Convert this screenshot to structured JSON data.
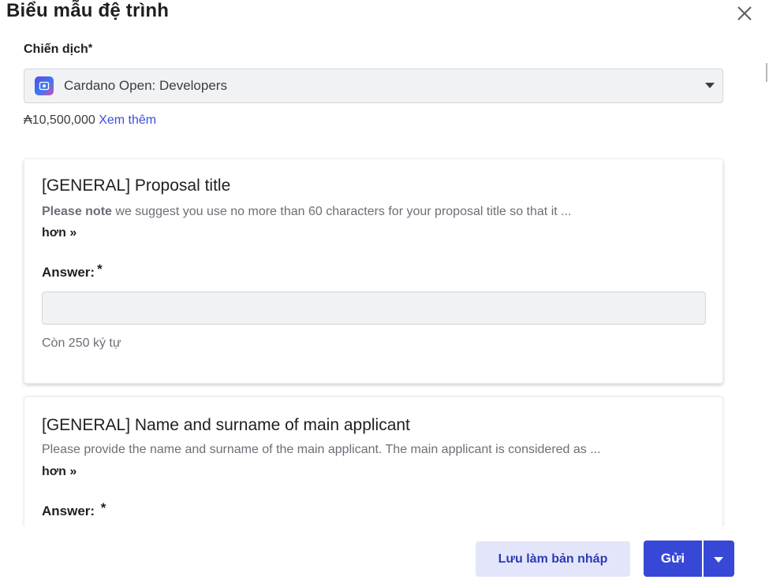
{
  "modal": {
    "title": "Biểu mẫu đệ trình",
    "close_icon": "close-icon"
  },
  "campaign": {
    "label": "Chiến dịch",
    "required_mark": "*",
    "selected": "Cardano Open: Developers",
    "icon": "campaign-logo-icon",
    "budget": "₳10,500,000",
    "more_link": "Xem thêm"
  },
  "questions": [
    {
      "title": "[GENERAL] Proposal title",
      "desc_bold": "Please note",
      "desc": " we suggest you use no more than 60 characters for your proposal title so that it ...",
      "more": "hơn »",
      "answer_label": "Answer:",
      "required_mark": "*",
      "value": "",
      "counter": "Còn 250 ký tự"
    },
    {
      "title": "[GENERAL] Name and surname of main applicant",
      "desc_bold": "",
      "desc": "Please provide the name and surname of the main applicant. The main applicant is considered as ...",
      "more": "hơn »",
      "answer_label": "Answer: ",
      "required_mark": "*"
    }
  ],
  "footer": {
    "draft_label": "Lưu làm bản nháp",
    "send_label": "Gửi",
    "send_menu_icon": "chevron-down-icon"
  },
  "colors": {
    "primary": "#3848d6",
    "secondary_bg": "#e3e6fa",
    "link": "#3b4fd8",
    "input_bg": "#f1f2f4"
  }
}
